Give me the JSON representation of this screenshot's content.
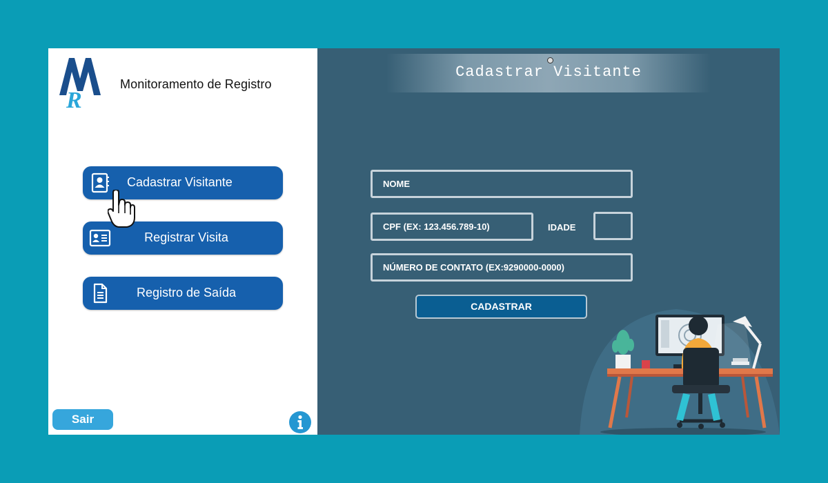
{
  "brand": {
    "logo_icon": "mr-logo-icon",
    "title": "Monitoramento de Registro",
    "colors": {
      "dark_blue": "#1a4e8c",
      "light_blue": "#2aa6d9"
    }
  },
  "sidebar": {
    "items": [
      {
        "label": "Cadastrar Visitante",
        "icon": "contact-book-icon"
      },
      {
        "label": "Registrar Visita",
        "icon": "id-card-icon"
      },
      {
        "label": "Registro de Saída",
        "icon": "document-icon"
      }
    ],
    "exit_label": "Sair",
    "info_icon": "info-icon"
  },
  "header": {
    "title": "Cadastrar Visitante"
  },
  "form": {
    "name_placeholder": "NOME",
    "cpf_placeholder": "CPF (EX: 123.456.789-10)",
    "age_label": "IDADE",
    "age_value": "",
    "contact_placeholder": "NÚMERO DE CONTATO (EX:9290000-0000)",
    "submit_label": "CADASTRAR"
  },
  "colors": {
    "page_bg": "#0a9db6",
    "panel_bg": "#375f75",
    "nav_button": "#1660ad",
    "exit_button": "#36a6dc",
    "submit_button": "#0a5e92"
  }
}
